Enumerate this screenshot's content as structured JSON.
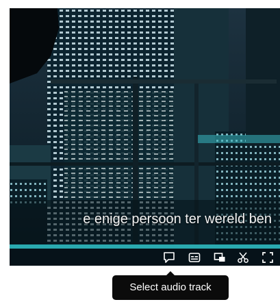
{
  "video": {
    "subtitle": "e enige persoon ter wereld ben",
    "progress": 1.0
  },
  "controls": {
    "buttons": [
      {
        "name": "audio-track-button",
        "icon": "speech-bubble-icon"
      },
      {
        "name": "subtitles-button",
        "icon": "captions-icon"
      },
      {
        "name": "picture-in-picture-button",
        "icon": "picture-in-picture-icon"
      },
      {
        "name": "clip-button",
        "icon": "scissors-icon"
      },
      {
        "name": "fullscreen-button",
        "icon": "fullscreen-icon"
      }
    ]
  },
  "tooltip": {
    "text": "Select audio track"
  },
  "colors": {
    "accent": "#2aaab0",
    "tooltip_bg": "#0b0b0b"
  }
}
